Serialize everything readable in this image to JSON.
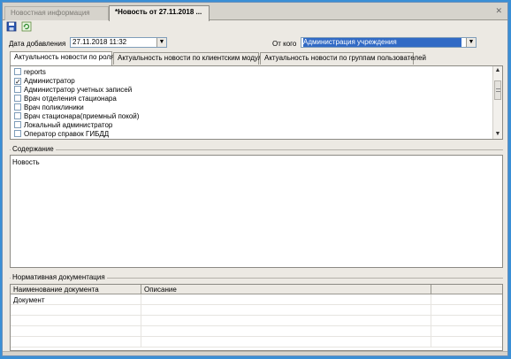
{
  "tabs": [
    {
      "label": "Новостная информация",
      "active": false
    },
    {
      "label": "*Новость от 27.11.2018 ...",
      "active": true
    }
  ],
  "icons": {
    "save": "save-icon",
    "refresh": "refresh-icon",
    "close": "close-icon"
  },
  "form": {
    "date_label": "Дата добавления",
    "date_value": "27.11.2018 11:32",
    "from_label": "От кого",
    "from_value": "Администрация учреждения"
  },
  "inner_tabs": [
    {
      "label": "Актуальность новости по ролям",
      "active": true
    },
    {
      "label": "Актуальность новости по клиентским модулям",
      "active": false
    },
    {
      "label": "Актуальность новости по группам пользователей",
      "active": false
    }
  ],
  "roles": [
    {
      "label": "reports",
      "checked": false
    },
    {
      "label": "Администратор",
      "checked": true
    },
    {
      "label": "Администратор учетных записей",
      "checked": false
    },
    {
      "label": "Врач отделения стационара",
      "checked": false
    },
    {
      "label": "Врач поликлиники",
      "checked": false
    },
    {
      "label": "Врач стационара(приемный покой)",
      "checked": false
    },
    {
      "label": "Локальный администратор",
      "checked": false
    },
    {
      "label": "Оператор справок ГИБДД",
      "checked": false
    }
  ],
  "content": {
    "title": "Содержание",
    "text": "Новость"
  },
  "docs": {
    "title": "Нормативная документация",
    "columns": [
      "Наименование документа",
      "Описание",
      ""
    ],
    "rows": [
      [
        "Документ",
        "",
        ""
      ]
    ]
  },
  "colors": {
    "accent": "#316ac5",
    "frame": "#3a8fd6"
  }
}
